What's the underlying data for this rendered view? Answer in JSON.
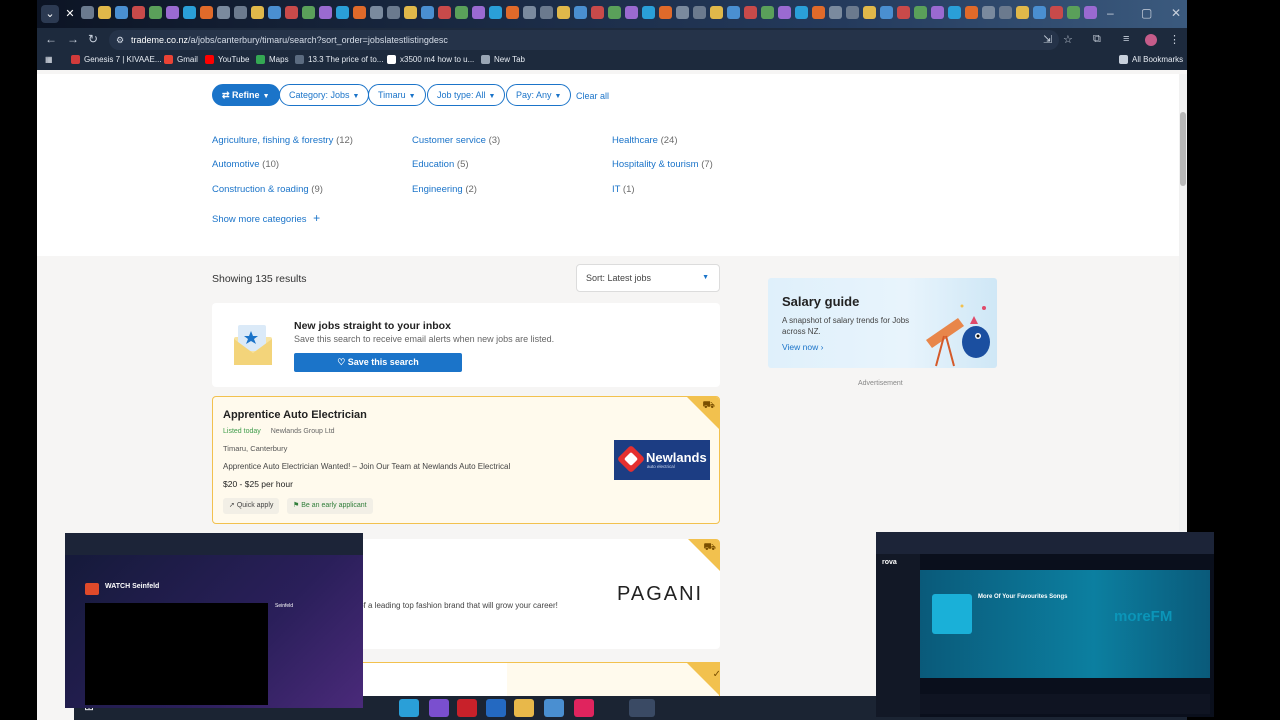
{
  "browser": {
    "tabs_icon_count": 66,
    "url_host": "trademe.co.nz",
    "url_path": "/a/jobs/canterbury/timaru/search?sort_order=jobslatestlistingdesc",
    "bookmarks": [
      "Genesis 7 | KIVAAE...",
      "Gmail",
      "YouTube",
      "Maps",
      "13.3 The price of to...",
      "x3500 m4 how to u...",
      "New Tab"
    ],
    "all_bookmarks": "All Bookmarks"
  },
  "filters": {
    "refine": "Refine",
    "category": "Category: Jobs",
    "location": "Timaru",
    "job_type": "Job type: All",
    "pay": "Pay: Any",
    "clear_all": "Clear all"
  },
  "categories": [
    {
      "name": "Agriculture, fishing & forestry",
      "count": "(12)"
    },
    {
      "name": "Automotive",
      "count": "(10)"
    },
    {
      "name": "Construction & roading",
      "count": "(9)"
    },
    {
      "name": "Customer service",
      "count": "(3)"
    },
    {
      "name": "Education",
      "count": "(5)"
    },
    {
      "name": "Engineering",
      "count": "(2)"
    },
    {
      "name": "Healthcare",
      "count": "(24)"
    },
    {
      "name": "Hospitality & tourism",
      "count": "(7)"
    },
    {
      "name": "IT",
      "count": "(1)"
    }
  ],
  "show_more": "Show more categories",
  "results": {
    "count_text": "Showing 135 results",
    "sort": "Sort: Latest jobs"
  },
  "alert": {
    "title": "New jobs straight to your inbox",
    "subtitle": "Save this search to receive email alerts when new jobs are listed.",
    "button": "Save this search"
  },
  "job1": {
    "title": "Apprentice Auto Electrician",
    "listed": "Listed today",
    "company": "Newlands Group Ltd",
    "location": "Timaru, Canterbury",
    "description": "Apprentice Auto Electrician Wanted! – Join Our Team at Newlands Auto Electrical",
    "pay": "$20 - $25 per hour",
    "tag_quick": "Quick apply",
    "tag_early": "Be an early applicant",
    "logo_text": "Newlands",
    "logo_tagline": "auto electrical"
  },
  "job2": {
    "description": "rt of a leading top fashion brand that will grow your career!",
    "logo_text": "PAGANI"
  },
  "salary": {
    "title": "Salary guide",
    "subtitle": "A snapshot of salary trends for Jobs across NZ.",
    "link": "View now",
    "ad_label": "Advertisement"
  },
  "pip_left": {
    "title": "WATCH Seinfeld",
    "show": "Seinfeld"
  },
  "pip_right": {
    "brand": "rova",
    "title": "More Of Your Favourites Songs",
    "station": "moreFM"
  },
  "colors": {
    "accent": "#1b74c9",
    "premium": "#f2c14e",
    "page_bg": "#f6f5f4"
  }
}
